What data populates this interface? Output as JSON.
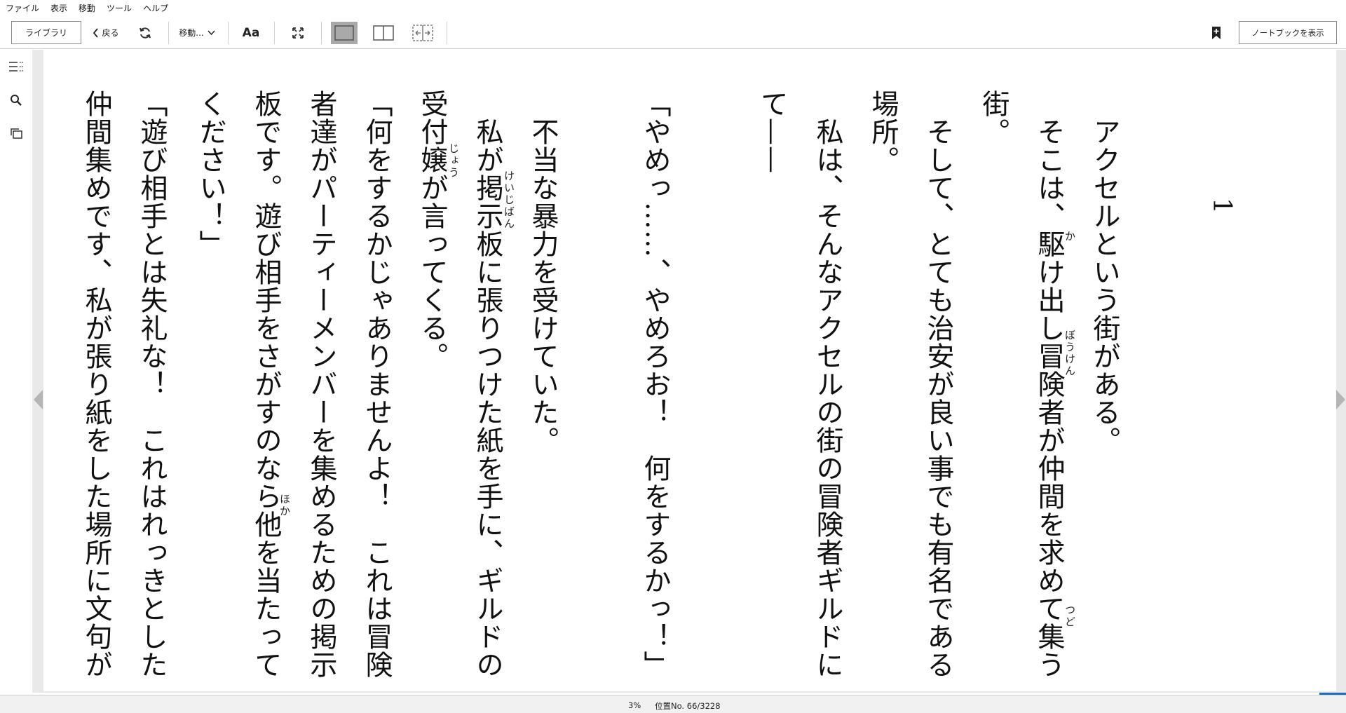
{
  "menu": [
    "ファイル",
    "表示",
    "移動",
    "ツール",
    "ヘルプ"
  ],
  "toolbar": {
    "library_label": "ライブラリ",
    "back_label": "戻る",
    "goto_label": "移動...",
    "font_label": "Aa",
    "notebook_label": "ノートブックを表示"
  },
  "icons": {
    "back": "chevron-left-icon",
    "refresh": "refresh-icon",
    "goto": "chevron-down-icon",
    "fullscreen": "fullscreen-icon",
    "single_page": "single-page-icon",
    "two_page": "two-page-icon",
    "fit": "fit-page-icon",
    "bookmark": "bookmark-add-icon",
    "toc": "toc-icon",
    "search": "search-icon",
    "flashcards": "flashcards-icon"
  },
  "book": {
    "chapter": "1",
    "columns": [
      "アクセルという街がある。",
      "そこは、駆け出し冒険者が仲間を求めて集う",
      "街。",
      "そして、とても治安が良い事でも有名である",
      "場所。",
      "私は、そんなアクセルの街の冒険者ギルドに",
      "て——",
      "「やめっ……、やめろお！　何をするかっ！」",
      "不当な暴力を受けていた。",
      "私が掲示板に張りつけた紙を手に、ギルドの",
      "受付嬢が言ってくる。",
      "「何をするかじゃありませんよ！　これは冒険",
      "者達がパーティーメンバーを集めるための掲示",
      "板です。遊び相手をさがすのなら他を当たって",
      "ください！」",
      "「遊び相手とは失礼な！　これはれっきとした",
      "仲間集めです、私が張り紙をした場所に文句が"
    ],
    "ruby": {
      "kakedashi": "か",
      "bouken": "ぼうけん",
      "tsudou": "つど",
      "keijiban": "けいじばん",
      "jou": "じょう",
      "hoka": "ほか"
    }
  },
  "status": {
    "percent": "3%",
    "location": "位置No. 66/3228"
  },
  "colors": {
    "active_view": "#a9a9a9",
    "progress": "#1a6fc2"
  }
}
